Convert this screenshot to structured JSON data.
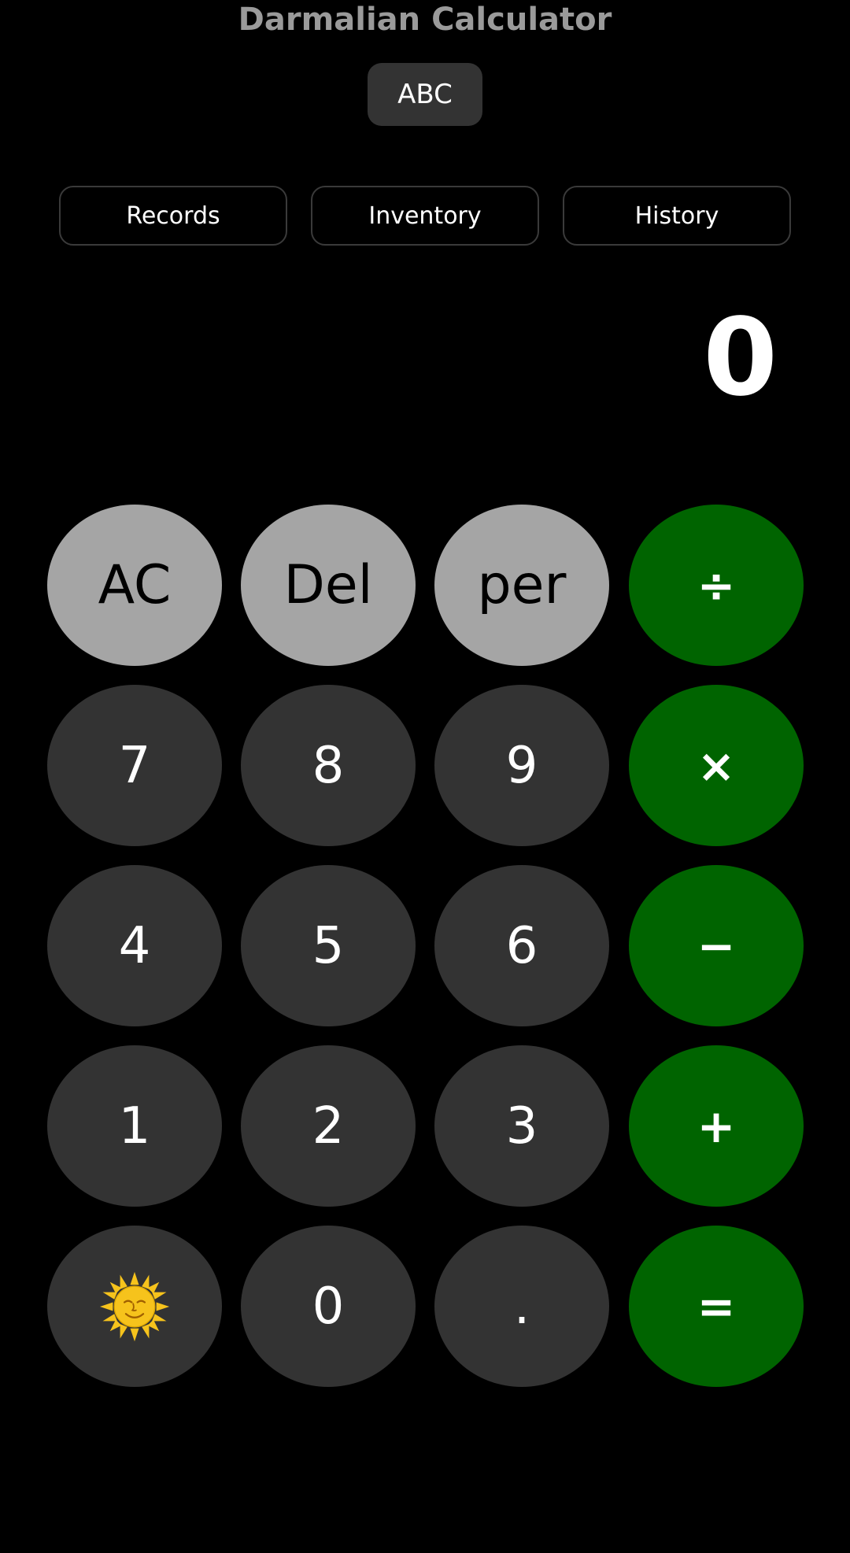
{
  "app": {
    "title": "Darmalian Calculator"
  },
  "mode_toggle": {
    "label": "ABC"
  },
  "nav": {
    "records_label": "Records",
    "inventory_label": "Inventory",
    "history_label": "History"
  },
  "display": {
    "value": "0"
  },
  "keypad": {
    "ac": "AC",
    "del": "Del",
    "per": "per",
    "divide": "÷",
    "seven": "7",
    "eight": "8",
    "nine": "9",
    "multiply": "×",
    "four": "4",
    "five": "5",
    "six": "6",
    "minus": "−",
    "one": "1",
    "two": "2",
    "three": "3",
    "plus": "+",
    "sun_icon": "sun-with-face-icon",
    "zero": "0",
    "decimal": ".",
    "equals": "="
  },
  "colors": {
    "background": "#000000",
    "title": "#9a9a9a",
    "function_key": "#a5a5a5",
    "number_key": "#333333",
    "operator_key": "#006400",
    "sun": "#f6c31c"
  }
}
